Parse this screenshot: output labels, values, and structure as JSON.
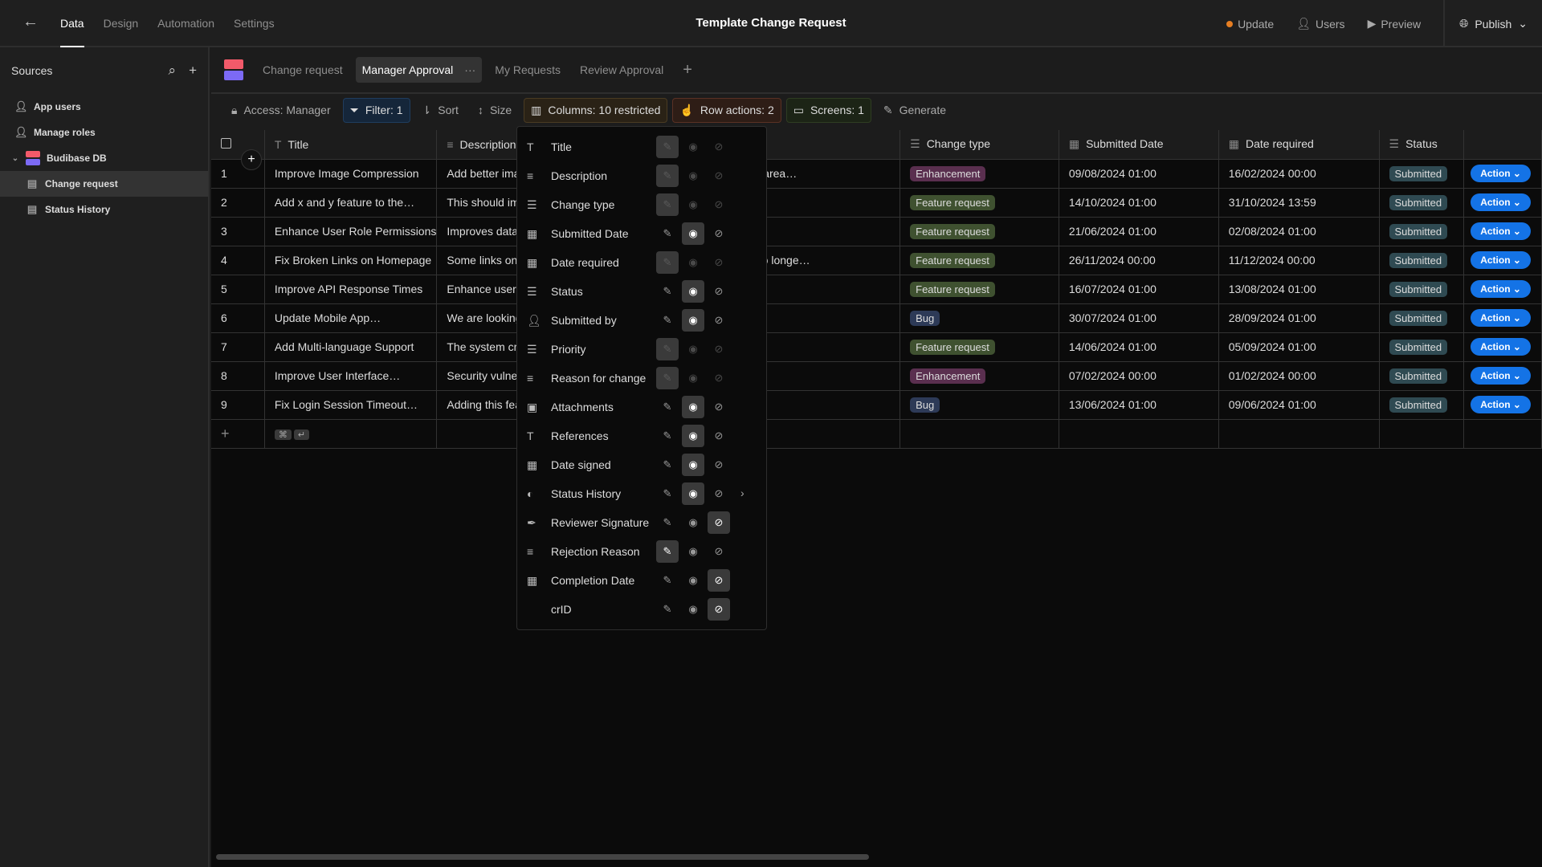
{
  "topbar": {
    "title": "Template Change Request",
    "nav": [
      "Data",
      "Design",
      "Automation",
      "Settings"
    ],
    "active_nav": "Data",
    "update": "Update",
    "users": "Users",
    "preview": "Preview",
    "publish": "Publish",
    "update_dot_color": "#e67e22"
  },
  "sidebar": {
    "title": "Sources",
    "items": [
      {
        "label": "App users"
      },
      {
        "label": "Manage roles"
      },
      {
        "label": "Budibase DB"
      },
      {
        "label": "Change request"
      },
      {
        "label": "Status History"
      }
    ]
  },
  "tabs": {
    "items": [
      "Change request",
      "Manager Approval",
      "My Requests",
      "Review Approval"
    ],
    "active": "Manager Approval",
    "more": "···",
    "add": "+"
  },
  "toolbar": {
    "access": "Access: Manager",
    "filter": "Filter: 1",
    "sort": "Sort",
    "size": "Size",
    "columns": "Columns: 10 restricted",
    "row_actions": "Row actions: 2",
    "screens": "Screens: 1",
    "generate": "Generate"
  },
  "table": {
    "headers": [
      "Title",
      "Description",
      "Change type",
      "Submitted Date",
      "Date required",
      "Status"
    ],
    "rows": [
      {
        "n": "1",
        "title": "Improve Image Compression",
        "desc": "Add better image",
        "desc_tail": "wer resolution in area…",
        "type": "Enhancement",
        "submitted": "09/08/2024 01:00",
        "required": "16/02/2024 00:00",
        "status": "Submitted"
      },
      {
        "n": "2",
        "title": "Add x and y feature to the…",
        "desc": "This should imrpo",
        "desc_tail": ".",
        "type": "Feature request",
        "submitted": "14/10/2024 01:00",
        "required": "31/10/2024 13:59",
        "status": "Submitted"
      },
      {
        "n": "3",
        "title": "Enhance User Role Permissions",
        "desc": "Improves data en",
        "desc_tail": "",
        "type": "Feature request",
        "submitted": "21/06/2024 01:00",
        "required": "02/08/2024 01:00",
        "status": "Submitted"
      },
      {
        "n": "4",
        "title": "Fix Broken Links on Homepage",
        "desc": "Some links on the",
        "desc_tail": "g to pages that no longe…",
        "type": "Feature request",
        "submitted": "26/11/2024 00:00",
        "required": "11/12/2024 00:00",
        "status": "Submitted"
      },
      {
        "n": "5",
        "title": "Improve API Response Times",
        "desc": "Enhance user acc",
        "desc_tail": "",
        "type": "Feature request",
        "submitted": "16/07/2024 01:00",
        "required": "13/08/2024 01:00",
        "status": "Submitted"
      },
      {
        "n": "6",
        "title": "Update Mobile App…",
        "desc": "We are looking to",
        "desc_tail": "",
        "type": "Bug",
        "submitted": "30/07/2024 01:00",
        "required": "28/09/2024 01:00",
        "status": "Submitted"
      },
      {
        "n": "7",
        "title": "Add Multi-language Support",
        "desc": "The system crash",
        "desc_tail": "",
        "type": "Feature request",
        "submitted": "14/06/2024 01:00",
        "required": "05/09/2024 01:00",
        "status": "Submitted"
      },
      {
        "n": "8",
        "title": "Improve User Interface…",
        "desc": "Security vulnerab",
        "desc_tail": "",
        "type": "Enhancement",
        "submitted": "07/02/2024 00:00",
        "required": "01/02/2024 00:00",
        "status": "Submitted"
      },
      {
        "n": "9",
        "title": "Fix Login Session Timeout…",
        "desc": "Adding this featu",
        "desc_tail": "",
        "type": "Bug",
        "submitted": "13/06/2024 01:00",
        "required": "09/06/2024 01:00",
        "status": "Submitted"
      }
    ],
    "action_label": "Action",
    "type_colors": {
      "Enhancement": "#5a2f4f",
      "Feature request": "#3f5130",
      "Bug": "#2d3a57"
    },
    "status_color": "#2f4a52"
  },
  "columns_popup": {
    "items": [
      {
        "label": "Title",
        "icon": "text-icon",
        "mode": "locked"
      },
      {
        "label": "Description",
        "icon": "longform-icon",
        "mode": "locked"
      },
      {
        "label": "Change type",
        "icon": "options-icon",
        "mode": "locked"
      },
      {
        "label": "Submitted Date",
        "icon": "calendar-icon",
        "mode": "read"
      },
      {
        "label": "Date required",
        "icon": "calendar-icon",
        "mode": "locked"
      },
      {
        "label": "Status",
        "icon": "options-icon",
        "mode": "read"
      },
      {
        "label": "Submitted by",
        "icon": "user-icon",
        "mode": "read"
      },
      {
        "label": "Priority",
        "icon": "options-icon",
        "mode": "locked"
      },
      {
        "label": "Reason for change",
        "icon": "longform-icon",
        "mode": "locked"
      },
      {
        "label": "Attachments",
        "icon": "attachment-icon",
        "mode": "read"
      },
      {
        "label": "References",
        "icon": "text-icon",
        "mode": "read"
      },
      {
        "label": "Date signed",
        "icon": "calendar-icon",
        "mode": "read"
      },
      {
        "label": "Status History",
        "icon": "relationship-icon",
        "mode": "read",
        "has_submenu": true
      },
      {
        "label": "Reviewer Signature",
        "icon": "signature-icon",
        "mode": "hidden"
      },
      {
        "label": "Rejection Reason",
        "icon": "longform-icon",
        "mode": "write"
      },
      {
        "label": "Completion Date",
        "icon": "calendar-icon",
        "mode": "hidden"
      },
      {
        "label": "crID",
        "icon": "",
        "mode": "hidden"
      }
    ]
  }
}
